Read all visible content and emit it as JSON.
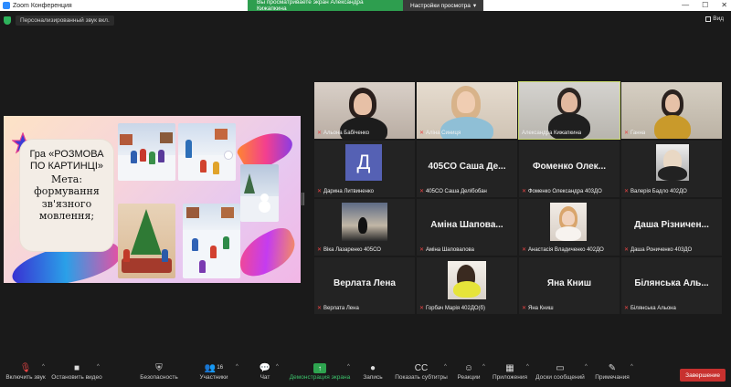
{
  "window": {
    "title": "Zoom Конференция",
    "controls": [
      "—",
      "☐",
      "✕"
    ]
  },
  "share_banner": {
    "text": "Вы просматриваете экран Александра Кижапкина",
    "view_settings": "Настройки просмотра"
  },
  "topbar": {
    "audio_label": "Персонализированный звук вкл.",
    "view_label": "Вид"
  },
  "slide": {
    "title": "Гра «РОЗМОВА ПО КАРТИНЦІ»",
    "subtitle": "Мета: формування зв'язного мовлення;"
  },
  "participants": [
    {
      "label": "Альона Бабіченко",
      "type": "video",
      "muted": true
    },
    {
      "label": "Аліна Синиця",
      "type": "video",
      "muted": true
    },
    {
      "label": "Александра Кижапкина",
      "type": "video",
      "muted": false,
      "active": true
    },
    {
      "label": "Ганна",
      "type": "video",
      "muted": true
    },
    {
      "label": "Дарина Литвиненко",
      "type": "avatar",
      "avatar_letter": "Д",
      "muted": true
    },
    {
      "label": "405СО Саша Делібобан",
      "bigname": "405СО Саша Де...",
      "type": "name",
      "muted": true
    },
    {
      "label": "Фоменко Олександра 403ДО",
      "bigname": "Фоменко Олек...",
      "type": "name",
      "muted": true
    },
    {
      "label": "Валерія Бадло 402ДО",
      "type": "photo",
      "muted": true
    },
    {
      "label": "Віка Лазаренко 405СО",
      "type": "photo",
      "muted": true
    },
    {
      "label": "Аміна Шаповалова",
      "bigname": "Аміна Шапова...",
      "type": "name",
      "muted": true
    },
    {
      "label": "Анастасія Владиченко 402ДО",
      "type": "photo",
      "muted": true
    },
    {
      "label": "Даша Рониченко 403ДО",
      "bigname": "Даша Різничен...",
      "type": "name",
      "muted": true
    },
    {
      "label": "Верлата Лена",
      "bigname": "Верлата Лена",
      "type": "name",
      "muted": true
    },
    {
      "label": "Горбач Марія 402ДО(б)",
      "type": "photo",
      "muted": true
    },
    {
      "label": "Яна Книш",
      "bigname": "Яна Книш",
      "type": "name",
      "muted": true
    },
    {
      "label": "Білянська Альона",
      "bigname": "Білянська Аль...",
      "type": "name",
      "muted": true
    }
  ],
  "toolbar": {
    "mute": "Включить звук",
    "video": "Остановить видео",
    "security": "Безопасность",
    "participants": "Участники",
    "participants_count": "16",
    "chat": "Чат",
    "share": "Демонстрация экрана",
    "record": "Запись",
    "captions": "Показать субтитры",
    "reactions": "Реакции",
    "apps": "Приложения",
    "whiteboards": "Доски сообщений",
    "notes": "Примечания",
    "end": "Завершение"
  },
  "colors": {
    "share_green": "#2e9e4f",
    "end_red": "#c8312f",
    "active_speaker": "#c8d86a",
    "avatar_blue": "#5561b4"
  }
}
